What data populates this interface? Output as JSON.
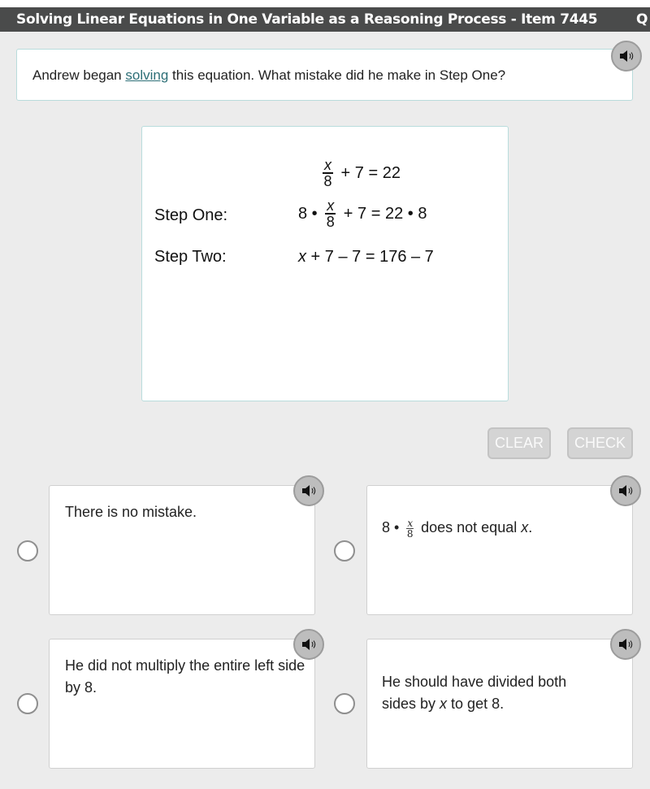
{
  "header": {
    "title": "Solving Linear Equations in One Variable as a Reasoning Process - Item 7445",
    "title_overflow": "Q"
  },
  "question": {
    "prefix": "Andrew began ",
    "link": "solving",
    "suffix": " this equation. What mistake did he make in Step One?",
    "audio_icon": "speaker-icon"
  },
  "equation": {
    "given": {
      "numerator": "x",
      "denominator": "8",
      "rest": " + 7 = 22"
    },
    "step_one": {
      "label": "Step One:",
      "lead": "8 • ",
      "numerator": "x",
      "denominator": "8",
      "rest": " + 7 = 22 • 8"
    },
    "step_two": {
      "label": "Step Two:",
      "var": "x",
      "rest": " + 7 – 7 = 176 – 7"
    }
  },
  "buttons": {
    "clear": "CLEAR",
    "check": "CHECK"
  },
  "choices": [
    {
      "text": "There is no mistake."
    },
    {
      "lead": "8 • ",
      "numerator": "x",
      "denominator": "8",
      "text": " does not equal ",
      "var": "x",
      "end": "."
    },
    {
      "text": "He did not multiply the entire left side by 8."
    },
    {
      "text_a": "He should have divided both sides by ",
      "var": "x",
      "text_b": " to get 8."
    }
  ],
  "colors": {
    "title_bar": "#4a4b4b",
    "link": "#2d6f77",
    "background": "#ececec",
    "box_border": "#b9dcdc",
    "button_disabled": "#d4d4d4"
  }
}
